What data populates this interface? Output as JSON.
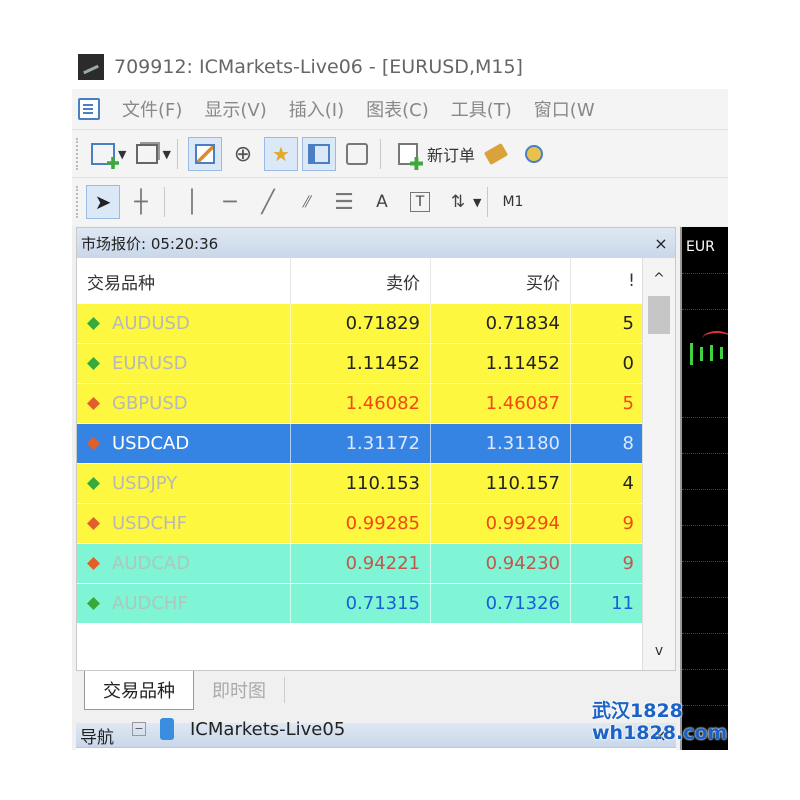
{
  "window": {
    "title": "709912: ICMarkets-Live06 - [EURUSD,M15]"
  },
  "menu": [
    "文件(F)",
    "显示(V)",
    "插入(I)",
    "图表(C)",
    "工具(T)",
    "窗口(W"
  ],
  "toolbar": {
    "new_order_label": "新订单",
    "timeframe": "M1"
  },
  "market_watch": {
    "title": "市场报价: 05:20:36",
    "columns": {
      "symbol": "交易品种",
      "bid": "卖价",
      "ask": "买价",
      "spread": "!"
    },
    "rows": [
      {
        "symbol": "AUDUSD",
        "bid": "0.71829",
        "ask": "0.71834",
        "spread": "5",
        "bg": "#fdf740",
        "sym_color": "#b8b8b8",
        "price_color": "#222222",
        "arrow": "#3aa83a"
      },
      {
        "symbol": "EURUSD",
        "bid": "1.11452",
        "ask": "1.11452",
        "spread": "0",
        "bg": "#fdf740",
        "sym_color": "#b8b8b8",
        "price_color": "#222222",
        "arrow": "#3aa83a"
      },
      {
        "symbol": "GBPUSD",
        "bid": "1.46082",
        "ask": "1.46087",
        "spread": "5",
        "bg": "#fdf740",
        "sym_color": "#b8b8b8",
        "price_color": "#f04a10",
        "arrow": "#e0602a"
      },
      {
        "symbol": "USDCAD",
        "bid": "1.31172",
        "ask": "1.31180",
        "spread": "8",
        "bg": "#3584e4",
        "sym_color": "#ffffff",
        "price_color": "#dce8ff",
        "arrow": "#e0602a"
      },
      {
        "symbol": "USDJPY",
        "bid": "110.153",
        "ask": "110.157",
        "spread": "4",
        "bg": "#fdf740",
        "sym_color": "#b8b8b8",
        "price_color": "#222222",
        "arrow": "#3aa83a"
      },
      {
        "symbol": "USDCHF",
        "bid": "0.99285",
        "ask": "0.99294",
        "spread": "9",
        "bg": "#fdf740",
        "sym_color": "#b8b8b8",
        "price_color": "#f04a10",
        "arrow": "#e0602a"
      },
      {
        "symbol": "AUDCAD",
        "bid": "0.94221",
        "ask": "0.94230",
        "spread": "9",
        "bg": "#7ff5d6",
        "sym_color": "#a9c9c0",
        "price_color": "#c0584a",
        "arrow": "#e0602a"
      },
      {
        "symbol": "AUDCHF",
        "bid": "0.71315",
        "ask": "0.71326",
        "spread": "11",
        "bg": "#7ff5d6",
        "sym_color": "#a9c9c0",
        "price_color": "#1a5fd6",
        "arrow": "#3aa83a"
      }
    ],
    "tabs": {
      "active": "交易品种",
      "inactive": "即时图"
    }
  },
  "navigator": {
    "title": "导航",
    "account": "ICMarkets-Live05"
  },
  "chart": {
    "tab_label": "EUR"
  },
  "watermark": {
    "line1": "武汉1828",
    "line2": "wh1828.com"
  }
}
